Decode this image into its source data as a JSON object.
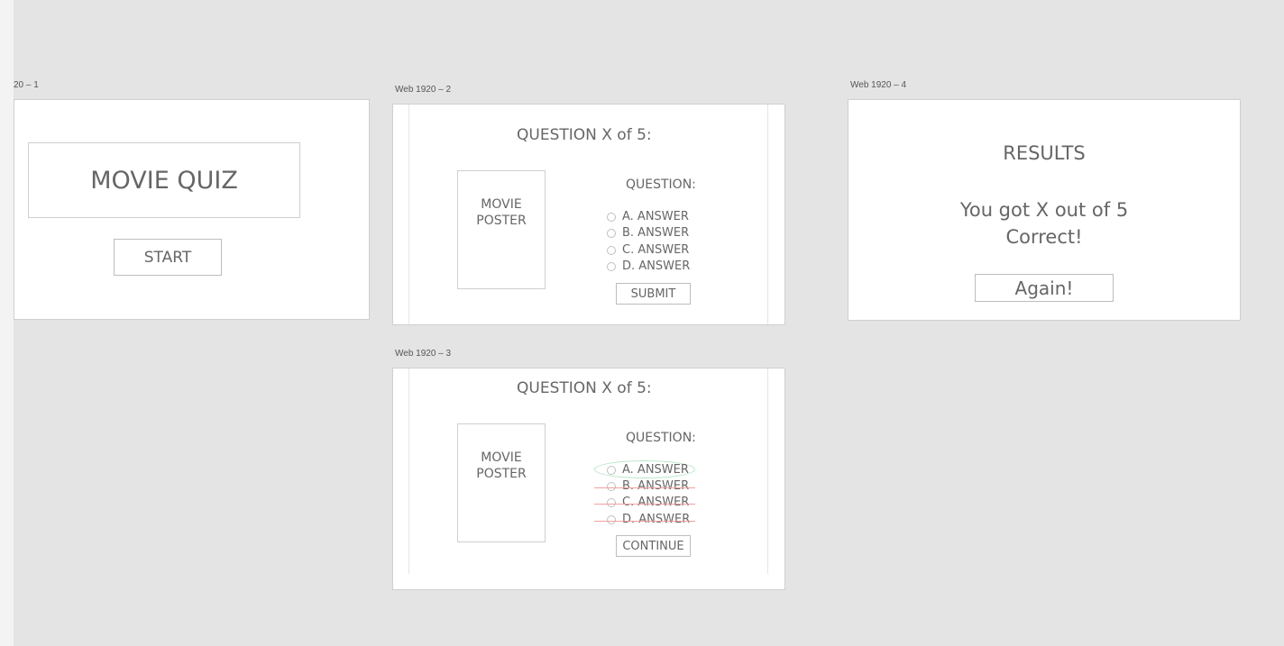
{
  "artboards": {
    "ab1": {
      "label": "20 – 1",
      "title": "MOVIE QUIZ",
      "start_label": "START"
    },
    "ab2": {
      "label": "Web 1920 – 2",
      "question_heading": "QUESTION X of 5:",
      "poster_line1": "MOVIE",
      "poster_line2": "POSTER",
      "question_label": "QUESTION:",
      "answers": [
        "A. ANSWER",
        "B. ANSWER",
        "C. ANSWER",
        "D. ANSWER"
      ],
      "submit_label": "SUBMIT"
    },
    "ab3": {
      "label": "Web 1920 – 3",
      "question_heading": "QUESTION X of 5:",
      "poster_line1": "MOVIE",
      "poster_line2": "POSTER",
      "question_label": "QUESTION:",
      "answers": [
        "A. ANSWER",
        "B. ANSWER",
        "C. ANSWER",
        "D. ANSWER"
      ],
      "continue_label": "CONTINUE"
    },
    "ab4": {
      "label": "Web 1920 – 4",
      "results_title": "RESULTS",
      "score_line1": "You got X out of 5",
      "score_line2": "Correct!",
      "again_label": "Again!"
    }
  },
  "colors": {
    "canvas_bg": "#e4e4e4",
    "correct_mark": "#b3e6c6",
    "incorrect_mark": "#f0a0a0"
  }
}
